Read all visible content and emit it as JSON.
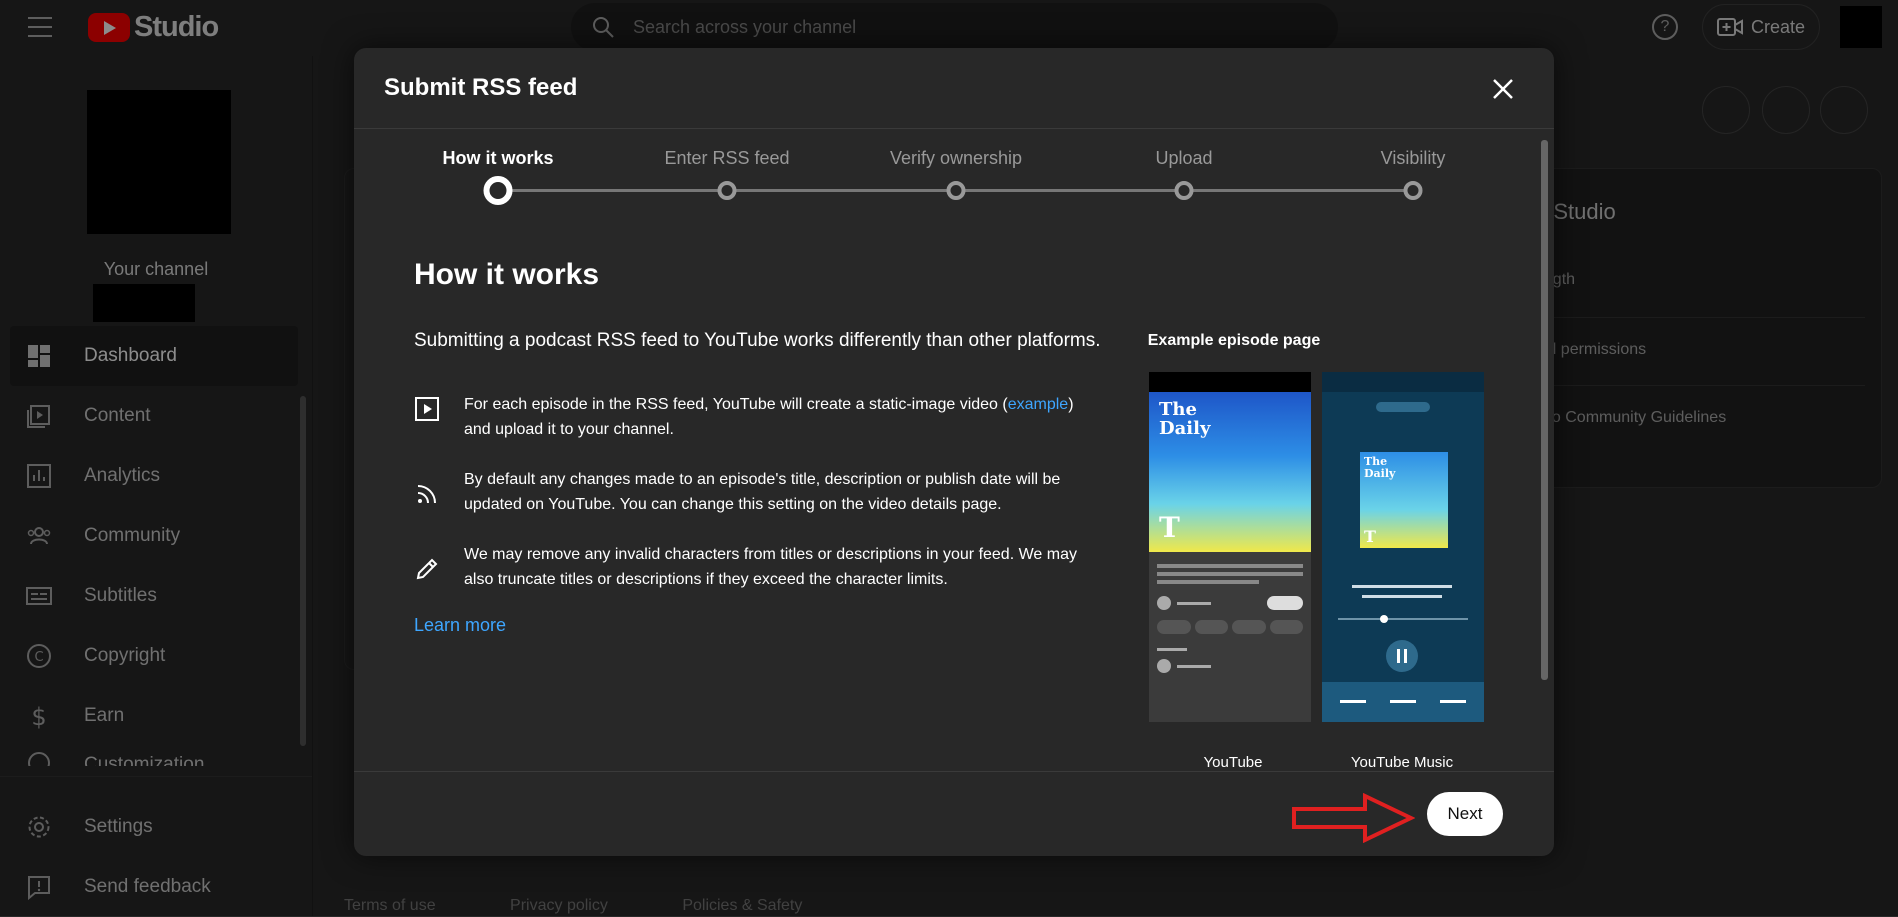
{
  "topbar": {
    "logo_text": "Studio",
    "search_placeholder": "Search across your channel",
    "create_label": "Create"
  },
  "sidebar": {
    "channel_label": "Your channel",
    "items": [
      {
        "label": "Dashboard",
        "icon": "dashboard-icon",
        "active": true
      },
      {
        "label": "Content",
        "icon": "content-icon"
      },
      {
        "label": "Analytics",
        "icon": "analytics-icon"
      },
      {
        "label": "Community",
        "icon": "community-icon"
      },
      {
        "label": "Subtitles",
        "icon": "subtitles-icon"
      },
      {
        "label": "Copyright",
        "icon": "copyright-icon"
      },
      {
        "label": "Earn",
        "icon": "earn-icon"
      },
      {
        "label": "Customization",
        "icon": "customization-icon"
      }
    ],
    "bottom_items": [
      {
        "label": "Settings",
        "icon": "gear-icon"
      },
      {
        "label": "Send feedback",
        "icon": "feedback-icon"
      }
    ]
  },
  "background": {
    "card_title": "n Studio",
    "card_rows": [
      "ength",
      "nel permissions",
      "s to Community Guidelines"
    ],
    "footer_links": [
      "Terms of use",
      "Privacy policy",
      "Policies & Safety"
    ]
  },
  "modal": {
    "title": "Submit RSS feed",
    "steps": [
      "How it works",
      "Enter RSS feed",
      "Verify ownership",
      "Upload",
      "Visibility"
    ],
    "active_step": 0,
    "heading": "How it works",
    "intro": "Submitting a podcast RSS feed to YouTube works differently than other platforms.",
    "bullets": [
      {
        "icon": "play-video-icon",
        "text_before": "For each episode in the RSS feed, YouTube will create a static-image video (",
        "link": "example",
        "text_after": ") and upload it to your channel."
      },
      {
        "icon": "rss-icon",
        "text": "By default any changes made to an episode's title, description or publish date will be updated on YouTube. You can change this setting on the video details page."
      },
      {
        "icon": "pencil-icon",
        "text": "We may remove any invalid characters from titles or descriptions in your feed. We may also truncate titles or descriptions if they exceed the character limits."
      }
    ],
    "learn_more": "Learn more",
    "example_title": "Example episode page",
    "phone_labels": [
      "YouTube",
      "YouTube Music"
    ],
    "podcast_cover": "The Daily",
    "next_label": "Next"
  }
}
